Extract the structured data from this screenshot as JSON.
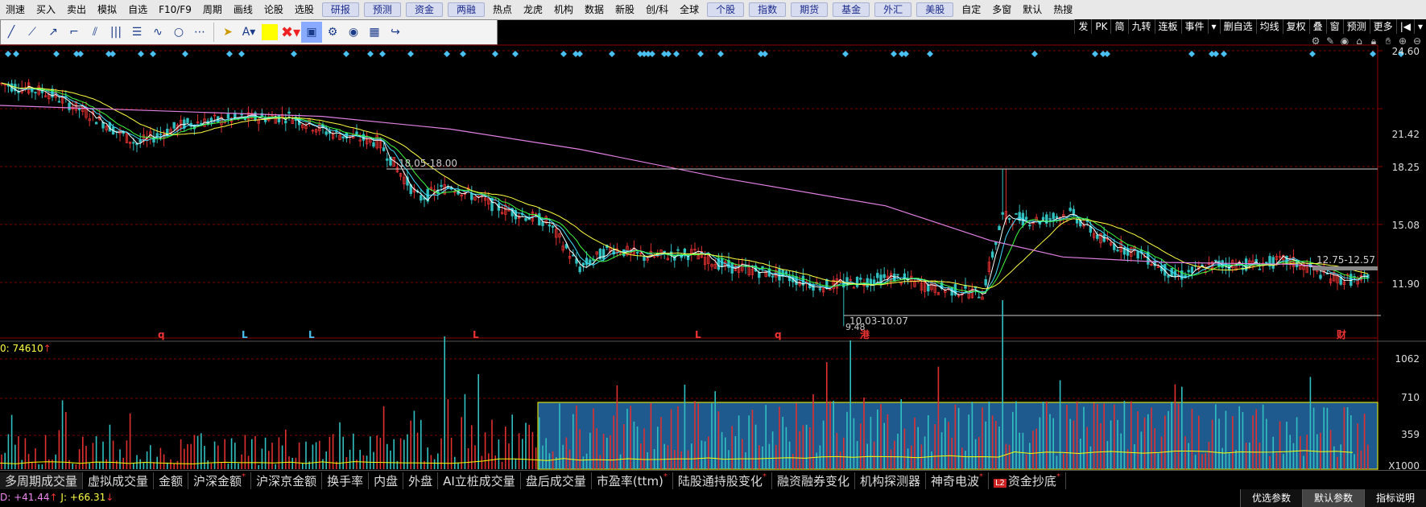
{
  "menu": {
    "items": [
      "测速",
      "买入",
      "卖出",
      "模拟",
      "自选",
      "F10/F9",
      "周期",
      "画线",
      "论股",
      "选股"
    ],
    "buttons": [
      "研报",
      "预测",
      "资金",
      "两融"
    ],
    "items2": [
      "热点",
      "龙虎",
      "机构",
      "数据",
      "新股",
      "创/科",
      "全球"
    ],
    "buttons2": [
      "个股",
      "指数",
      "期货",
      "基金",
      "外汇",
      "美股"
    ],
    "items3": [
      "自定",
      "多窗",
      "默认",
      "热搜"
    ]
  },
  "right_toolbar": [
    "发",
    "PK",
    "简",
    "九转",
    "连板",
    "事件",
    "▾",
    "删自选",
    "均线",
    "复权",
    "叠",
    "窗",
    "预测",
    "更多",
    "|◀",
    "▾"
  ],
  "price_axis": [
    "24.60",
    "21.42",
    "18.25",
    "15.08",
    "11.90"
  ],
  "volume_axis": [
    "1062",
    "710",
    "359",
    "X1000"
  ],
  "annotations": {
    "high_range": "18.05-18.00",
    "low_range": "10.03-10.07",
    "low_point": "9.48",
    "right_range": "12.75-12.57"
  },
  "event_markers": [
    "q",
    "L",
    "L",
    "L",
    "L",
    "q",
    "港",
    "财"
  ],
  "volume_label": {
    "prefix": "0: 74610",
    "arrow": "↑"
  },
  "indicator_tabs": [
    {
      "label": "多周期成交量",
      "star": false
    },
    {
      "label": "虚拟成交量",
      "star": false
    },
    {
      "label": "金额",
      "star": false
    },
    {
      "label": "沪深金额",
      "star": true
    },
    {
      "label": "沪深京金额",
      "star": false
    },
    {
      "label": "换手率",
      "star": false
    },
    {
      "label": "内盘",
      "star": false
    },
    {
      "label": "外盘",
      "star": false
    },
    {
      "label": "AI立桩成交量",
      "star": false
    },
    {
      "label": "盘后成交量",
      "star": false
    },
    {
      "label": "市盈率(ttm)",
      "star": true
    },
    {
      "label": "陆股通持股变化",
      "star": true
    },
    {
      "label": "融资融券变化",
      "star": false
    },
    {
      "label": "机构探测器",
      "star": false
    },
    {
      "label": "神奇电波",
      "star": true
    },
    {
      "label": "资金抄底",
      "star": true,
      "badge": "L2"
    }
  ],
  "footer": {
    "d_value": "D: +41.44",
    "d_arrow": "↑",
    "j_value": "J: +66.31",
    "j_arrow": "↓",
    "buttons": [
      "优选参数",
      "默认参数",
      "指标说明"
    ]
  },
  "colors": {
    "up": "#e03030",
    "down": "#30c0c0",
    "ma5": "#ffffff",
    "ma10": "#ffff40",
    "ma20": "#ff40ff",
    "ma60": "#40ff40",
    "highlight": "#1e5a8e"
  }
}
